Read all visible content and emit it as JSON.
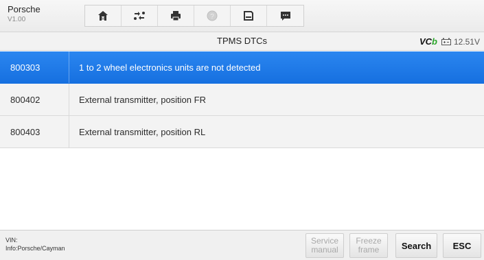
{
  "app": {
    "name": "Porsche",
    "version": "V1.00"
  },
  "toolbar": {
    "tools": [
      {
        "icon": "home-icon"
      },
      {
        "icon": "vehicle-swap-icon"
      },
      {
        "icon": "printer-icon"
      },
      {
        "icon": "help-icon"
      },
      {
        "icon": "save-icon"
      },
      {
        "icon": "data-log-icon"
      }
    ]
  },
  "titlebar": {
    "title": "TPMS DTCs",
    "vci": {
      "prefix": "VC",
      "suffix": "b"
    },
    "voltage": "12.51V"
  },
  "dtcs": [
    {
      "code": "800303",
      "description": "1 to 2 wheel electronics units are not detected",
      "selected": true
    },
    {
      "code": "800402",
      "description": "External transmitter, position FR",
      "selected": false
    },
    {
      "code": "800403",
      "description": "External transmitter, position RL",
      "selected": false
    }
  ],
  "footer": {
    "vin": "VIN:",
    "info": "Info:Porsche/Cayman",
    "buttons": {
      "service_manual": "Service manual",
      "freeze_frame": "Freeze frame",
      "search": "Search",
      "esc": "ESC"
    }
  },
  "colors": {
    "selected_row": "#1670e0",
    "vci_accent": "#2aa52a"
  }
}
